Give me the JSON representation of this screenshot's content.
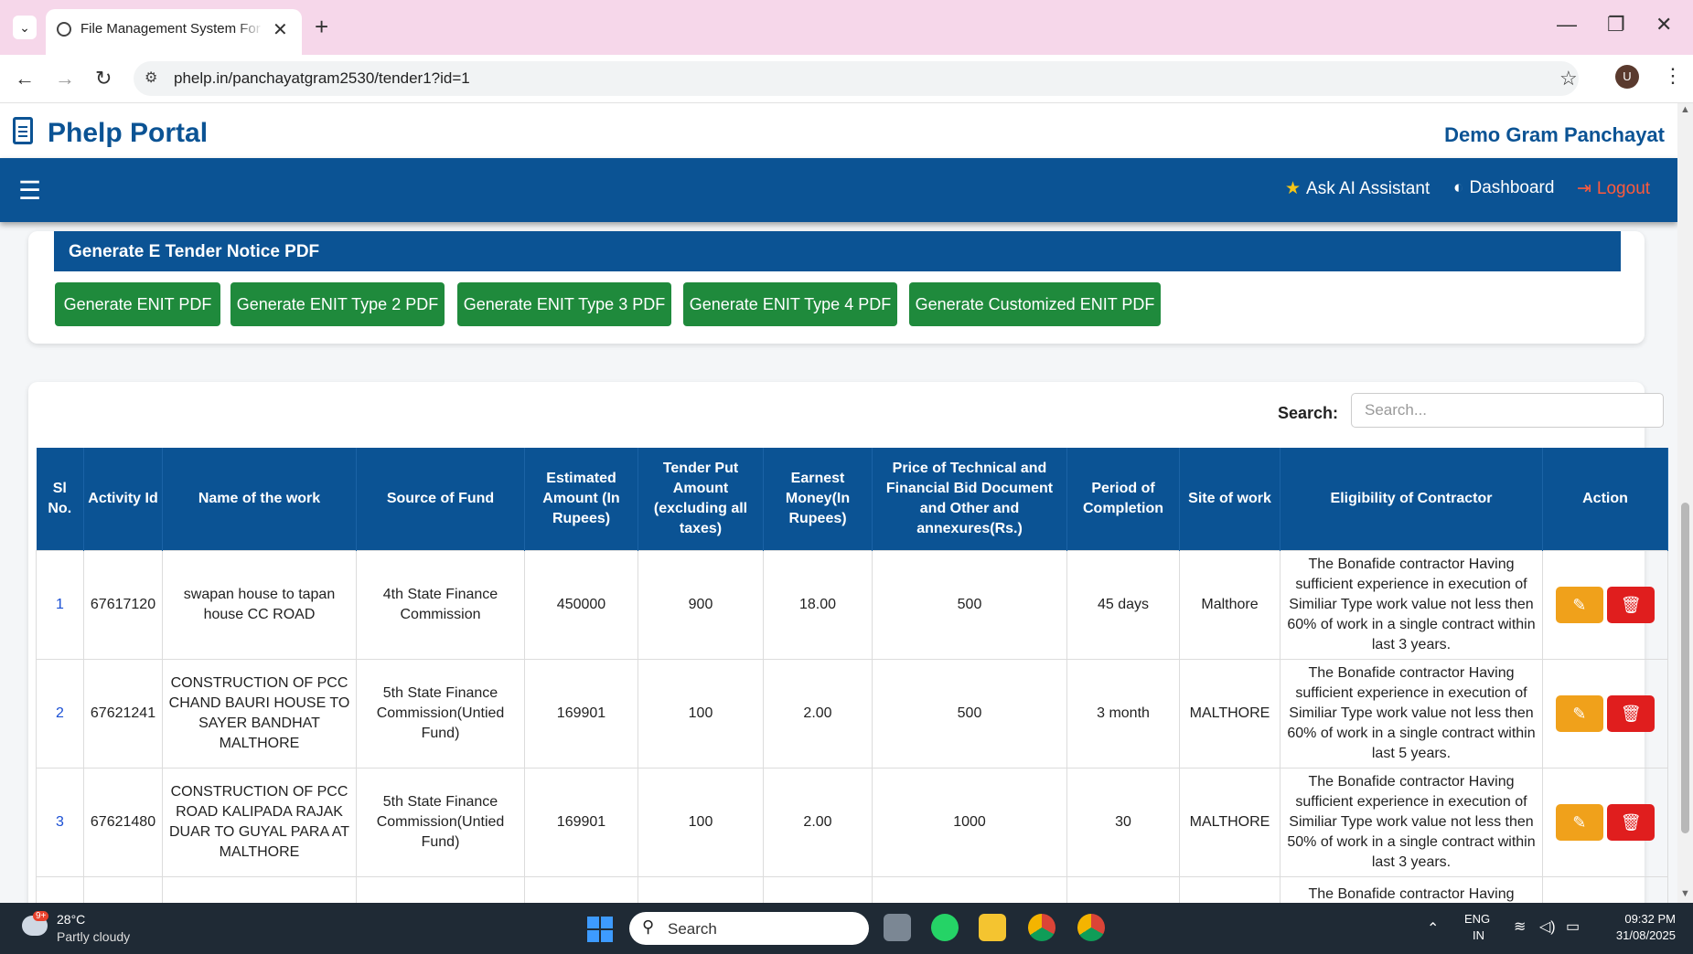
{
  "browser": {
    "tab_title": "File Management System For G",
    "tab_close": "✕",
    "new_tab": "+",
    "url": "phelp.in/panchayatgram2530/tender1?id=1",
    "profile_initial": "U"
  },
  "header": {
    "brand": "Phelp Portal",
    "organization": "Demo Gram Panchayat"
  },
  "navbar": {
    "ai_label": "Ask AI Assistant",
    "dashboard_label": "Dashboard",
    "logout_label": "Logout"
  },
  "tender_pdf": {
    "heading": "Generate E Tender Notice PDF",
    "buttons": [
      "Generate ENIT PDF",
      "Generate ENIT Type 2 PDF",
      "Generate ENIT Type 3 PDF",
      "Generate ENIT Type 4 PDF",
      "Generate Customized ENIT PDF"
    ]
  },
  "search": {
    "label": "Search:",
    "placeholder": "Search..."
  },
  "table": {
    "headers": [
      "Sl No.",
      "Activity Id",
      "Name of the work",
      "Source of Fund",
      "Estimated Amount (In Rupees)",
      "Tender Put Amount (excluding all taxes)",
      "Earnest Money(In Rupees)",
      "Price of Technical and Financial Bid Document and Other and annexures(Rs.)",
      "Period of Completion",
      "Site of work",
      "Eligibility of Contractor",
      "Action"
    ],
    "rows": [
      {
        "sl": "1",
        "activity_id": "67617120",
        "name": "swapan house to tapan house CC ROAD",
        "fund": "4th State Finance Commission",
        "estimated": "450000",
        "tender_put": "900",
        "earnest": "18.00",
        "price": "500",
        "period": "45 days",
        "site": "Malthore",
        "eligibility": "The Bonafide contractor Having sufficient experience in execution of Similiar Type work value not less then 60% of work in a single contract within last 3 years."
      },
      {
        "sl": "2",
        "activity_id": "67621241",
        "name": "CONSTRUCTION OF PCC CHAND BAURI HOUSE TO SAYER BANDHAT MALTHORE",
        "fund": "5th State Finance Commission(Untied Fund)",
        "estimated": "169901",
        "tender_put": "100",
        "earnest": "2.00",
        "price": "500",
        "period": "3 month",
        "site": "MALTHORE",
        "eligibility": "The Bonafide contractor Having sufficient experience in execution of Similiar Type work value not less then 60% of work in a single contract within last 5 years."
      },
      {
        "sl": "3",
        "activity_id": "67621480",
        "name": "CONSTRUCTION OF PCC ROAD KALIPADA RAJAK DUAR TO GUYAL PARA AT MALTHORE",
        "fund": "5th State Finance Commission(Untied Fund)",
        "estimated": "169901",
        "tender_put": "100",
        "earnest": "2.00",
        "price": "1000",
        "period": "30",
        "site": "MALTHORE",
        "eligibility": "The Bonafide contractor Having sufficient experience in execution of Similiar Type work value not less then 50% of work in a single contract within last 3 years."
      },
      {
        "sl": "",
        "activity_id": "",
        "name": "",
        "fund": "",
        "estimated": "",
        "tender_put": "",
        "earnest": "",
        "price": "",
        "period": "",
        "site": "",
        "eligibility": "The Bonafide contractor Having"
      }
    ]
  },
  "taskbar": {
    "weather_badge": "9+",
    "temperature": "28°C",
    "weather": "Partly cloudy",
    "search_label": "Search",
    "lang_top": "ENG",
    "lang_bottom": "IN",
    "time": "09:32 PM",
    "date": "31/08/2025"
  },
  "colors": {
    "primary": "#0b5394",
    "generate_button": "#1f8a3c",
    "edit_button": "#f0a11b",
    "delete_button": "#e01e1e",
    "logout": "#ff5a3c"
  }
}
